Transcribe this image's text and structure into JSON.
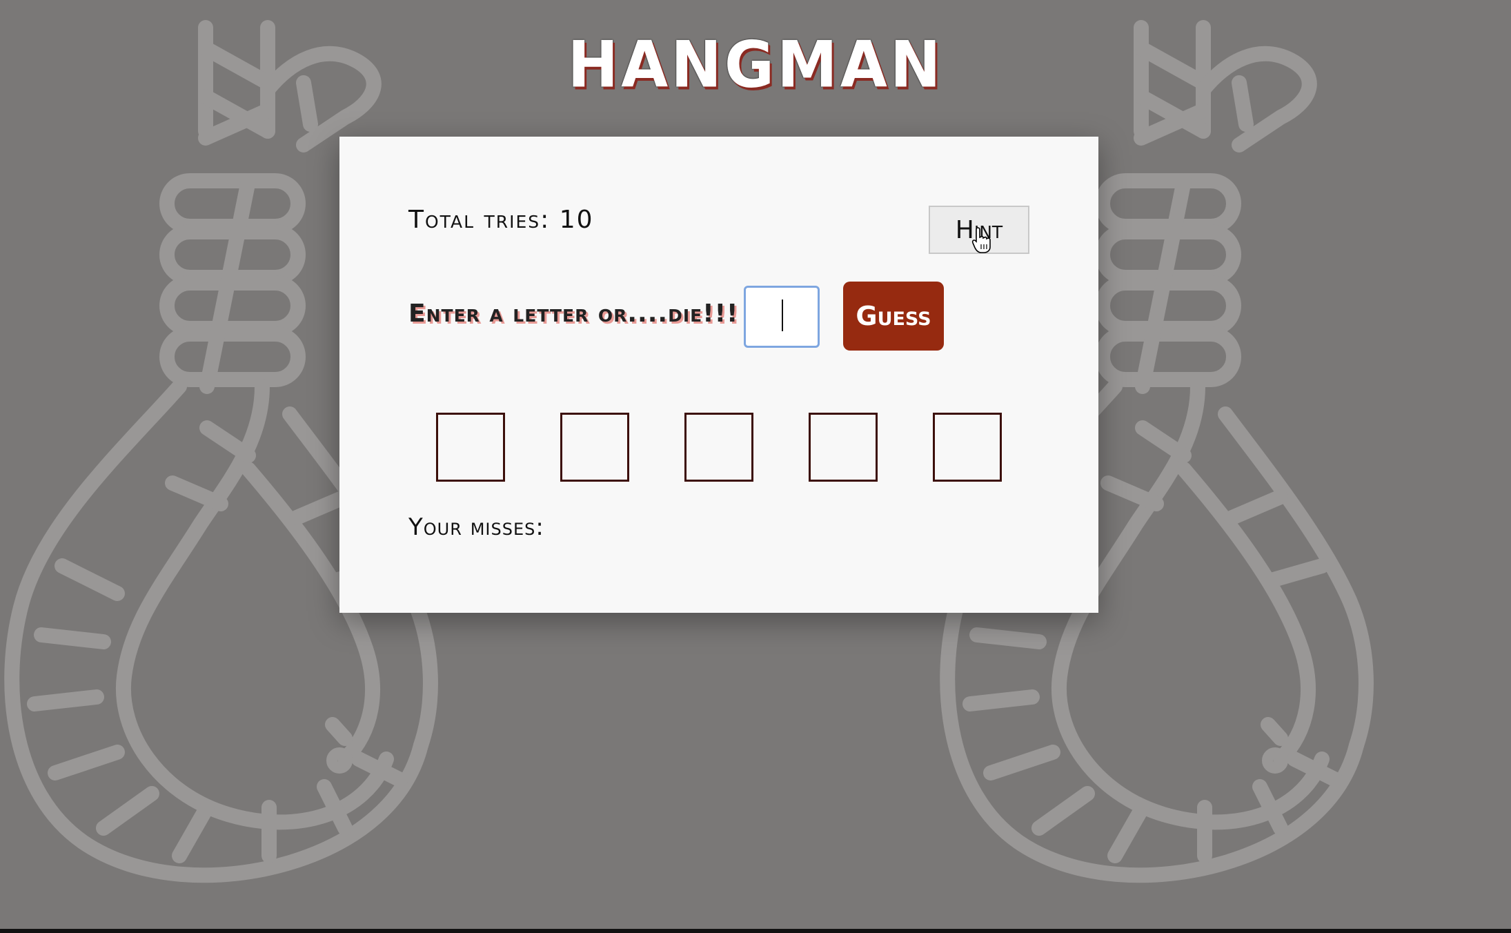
{
  "title": "HANGMAN",
  "game": {
    "tries_label": "Total tries:",
    "tries_value": "10",
    "hint_label": "Hint",
    "prompt": "Enter a letter or....die!!!",
    "input_value": "",
    "guess_label": "Guess",
    "word_slots": [
      "",
      "",
      "",
      "",
      ""
    ],
    "misses_label": "Your misses:",
    "misses_value": ""
  },
  "colors": {
    "background": "#7a7877",
    "card": "#f8f8f8",
    "guess_button": "#962a10",
    "slot_border": "#3c0f0a",
    "title_shadow": "#8a2a22",
    "input_focus_border": "#7ea6e0"
  },
  "icons": {
    "background_left": "noose-icon",
    "background_right": "noose-icon",
    "cursor": "hand-pointer-icon"
  }
}
